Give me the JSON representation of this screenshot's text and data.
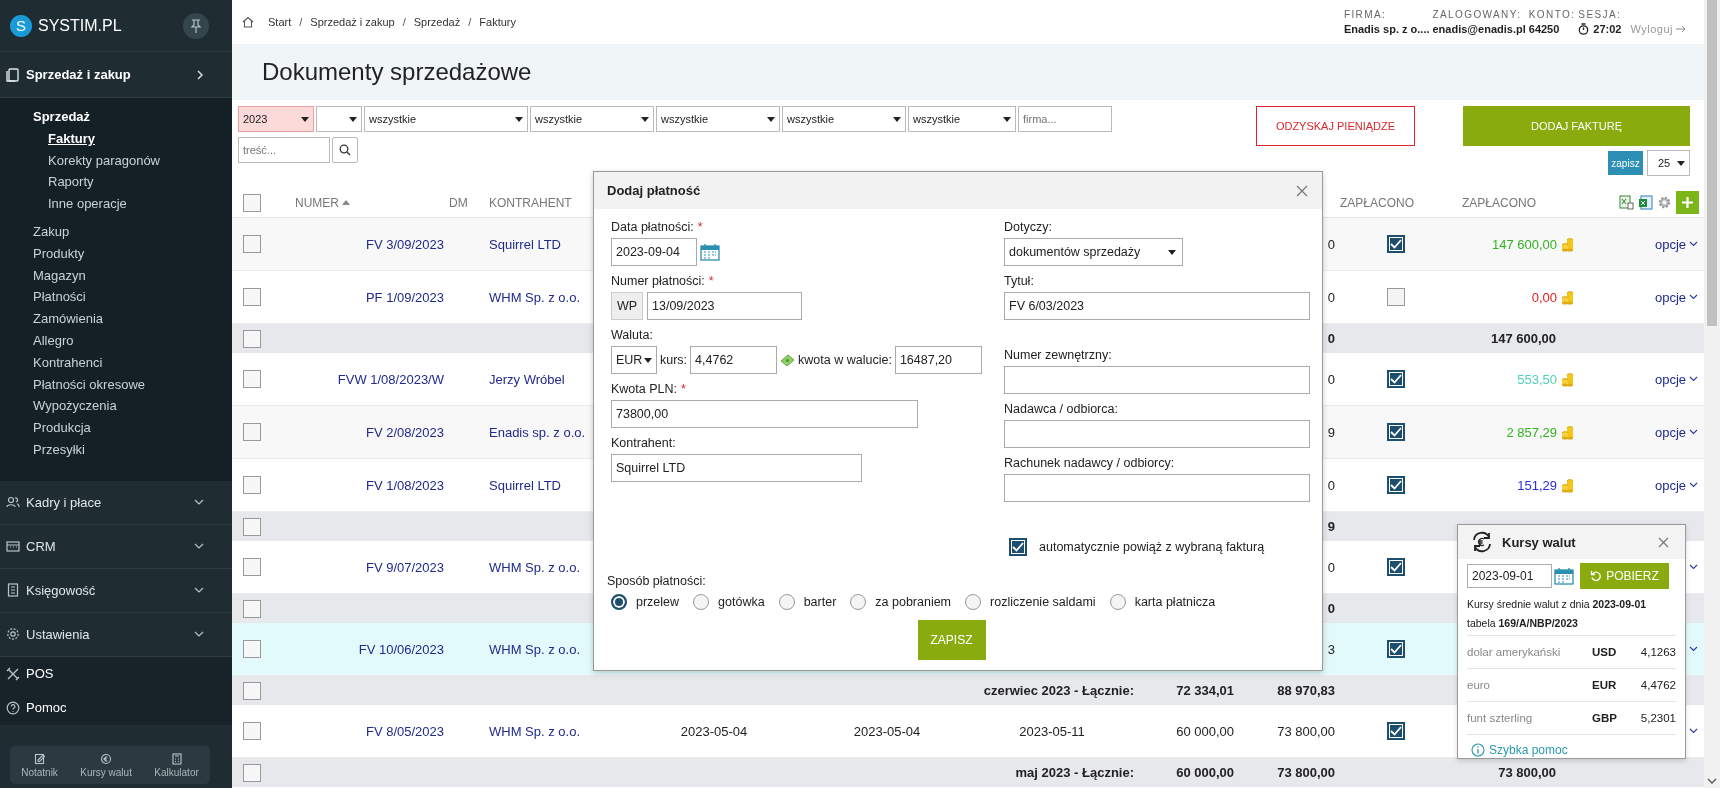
{
  "sidebar": {
    "logo_letter": "S",
    "brand": "SYSTIM.PL",
    "sections": [
      {
        "label": "Sprzedaż i zakup",
        "expanded": true,
        "children": [
          {
            "label": "Sprzedaż",
            "selected": false,
            "children": [
              {
                "label": "Faktury",
                "selected": true
              },
              {
                "label": "Korekty paragonów",
                "selected": false
              },
              {
                "label": "Raporty",
                "selected": false
              },
              {
                "label": "Inne operacje",
                "selected": false
              }
            ]
          },
          {
            "label": "Zakup",
            "selected": false
          },
          {
            "label": "Produkty",
            "selected": false
          },
          {
            "label": "Magazyn",
            "selected": false
          },
          {
            "label": "Płatności",
            "selected": false
          },
          {
            "label": "Zamówienia",
            "selected": false
          },
          {
            "label": "Allegro",
            "selected": false
          },
          {
            "label": "Kontrahenci",
            "selected": false
          },
          {
            "label": "Płatności okresowe",
            "selected": false
          },
          {
            "label": "Wypożyczenia",
            "selected": false
          },
          {
            "label": "Produkcja",
            "selected": false
          },
          {
            "label": "Przesyłki",
            "selected": false
          }
        ]
      },
      {
        "label": "Kadry i płace",
        "expanded": false
      },
      {
        "label": "CRM",
        "expanded": false
      },
      {
        "label": "Księgowość",
        "expanded": false
      },
      {
        "label": "Ustawienia",
        "expanded": false
      },
      {
        "label": "POS"
      },
      {
        "label": "Pomoc"
      }
    ],
    "tools": [
      {
        "label": "Notatnik"
      },
      {
        "label": "Kursy walut"
      },
      {
        "label": "Kalkulator"
      }
    ]
  },
  "breadcrumb": {
    "separator": "/",
    "items": [
      "Start",
      "Sprzedaż i zakup",
      "Sprzedaż",
      "Faktury"
    ]
  },
  "session": [
    {
      "label": "FIRMA:",
      "value": "Enadis sp. z o...."
    },
    {
      "label": "ZALOGOWANY:",
      "value": "enadis@enadis.pl"
    },
    {
      "label": "KONTO:",
      "value": "64250"
    },
    {
      "label": "SESJA:",
      "value": "27:02",
      "kind": "timer"
    }
  ],
  "logout": "Wyloguj",
  "page_title": "Dokumenty sprzedażowe",
  "filters": [
    {
      "kind": "select",
      "value": "2023",
      "highlighted": true
    },
    {
      "kind": "select",
      "highlighted": false
    },
    {
      "kind": "select",
      "value": "wszystkie",
      "highlighted": false
    },
    {
      "kind": "select",
      "value": "wszystkie",
      "highlighted": false
    },
    {
      "kind": "select",
      "value": "wszystkie",
      "highlighted": false
    },
    {
      "kind": "select",
      "value": "wszystkie",
      "highlighted": false
    },
    {
      "kind": "select",
      "value": "wszystkie",
      "highlighted": false
    },
    {
      "kind": "input",
      "placeholder": "firma..."
    }
  ],
  "search": {
    "placeholder": "treść..."
  },
  "recover_button": "ODZYSKAJ PIENIĄDZE",
  "add_button": "DODAJ FAKTURĘ",
  "save_view_button": "zapisz",
  "page_size": "25",
  "table": {
    "all_checked": false,
    "columns": [
      {
        "kind": "number",
        "label": "NUMER"
      },
      {
        "kind": "dm",
        "label": "DM"
      },
      {
        "kind": "client",
        "label": "KONTRAHENT"
      },
      {
        "kind": "paid_flag",
        "label": "ZAPŁACONO"
      },
      {
        "kind": "paid_amount",
        "label": "ZAPŁACONO"
      }
    ],
    "rows": [
      {
        "kind": "invoice",
        "checked": false,
        "number": "FV 3/09/2023",
        "client": "Squirrel LTD",
        "gross": "0",
        "paid": true,
        "paid_amount": "147 600,00",
        "color": "#33b320",
        "options": "opcje",
        "highlighted": false
      },
      {
        "kind": "invoice",
        "checked": false,
        "number": "PF 1/09/2023",
        "client": "WHM Sp. z o.o.",
        "gross": "0",
        "paid": false,
        "paid_amount": "0,00",
        "color": "#e0201c",
        "options": "opcje",
        "highlighted": false
      },
      {
        "kind": "summary",
        "checked": false,
        "gross": "0",
        "paid_amount": "147 600,00"
      },
      {
        "kind": "invoice",
        "checked": false,
        "number": "FVW 1/08/2023/W",
        "client": "Jerzy Wróbel",
        "gross": "0",
        "paid": true,
        "paid_amount": "553,50",
        "color": "#4fd0b8",
        "options": "opcje",
        "highlighted": false
      },
      {
        "kind": "invoice",
        "checked": false,
        "number": "FV 2/08/2023",
        "client": "Enadis sp. z o.o.",
        "gross": "9",
        "paid": true,
        "paid_amount": "2 857,29",
        "color": "#33b320",
        "options": "opcje",
        "highlighted": false
      },
      {
        "kind": "invoice",
        "checked": false,
        "number": "FV 1/08/2023",
        "client": "Squirrel LTD",
        "gross": "0",
        "paid": true,
        "paid_amount": "151,29",
        "color": "#2b2be0",
        "options": "opcje",
        "highlighted": false
      },
      {
        "kind": "summary",
        "checked": false,
        "gross": "9"
      },
      {
        "kind": "invoice",
        "checked": false,
        "number": "FV 9/07/2023",
        "client": "WHM Sp. z o.o.",
        "gross": "0",
        "paid": true,
        "highlighted": false
      },
      {
        "kind": "summary",
        "checked": false,
        "gross": "0"
      },
      {
        "kind": "invoice",
        "checked": false,
        "number": "FV 10/06/2023",
        "client": "WHM Sp. z o.o.",
        "gross": "3",
        "paid": true,
        "highlighted": true
      },
      {
        "kind": "summary",
        "checked": false,
        "label": "czerwiec 2023 - Łącznie:",
        "net": "72 334,01",
        "gross": "88 970,83"
      },
      {
        "kind": "invoice",
        "checked": false,
        "number": "FV 8/05/2023",
        "client": "WHM Sp. z o.o.",
        "issue_date": "2023-05-04",
        "sale_date": "2023-05-04",
        "due_date": "2023-05-11",
        "net": "60 000,00",
        "gross": "73 800,00",
        "paid": true,
        "highlighted": false
      },
      {
        "kind": "summary",
        "checked": false,
        "label": "maj 2023 - Łącznie:",
        "net": "60 000,00",
        "gross": "73 800,00",
        "paid_amount": "73 800,00"
      }
    ]
  },
  "payment_dialog": {
    "title": "Dodaj płatność",
    "date": {
      "label": "Data płatności:",
      "required_mark": "*",
      "value": "2023-09-04"
    },
    "number": {
      "label": "Numer płatności:",
      "required_mark": "*",
      "prefix": "WP",
      "value": "13/09/2023"
    },
    "currency": {
      "label": "Waluta:",
      "value": "EUR",
      "rate_label": "kurs:",
      "rate": "4,4762",
      "amount_label": "kwota w walucie:",
      "amount": "16487,20"
    },
    "amount_pln": {
      "label": "Kwota PLN:",
      "required_mark": "*",
      "value": "73800,00"
    },
    "client": {
      "label": "Kontrahent:",
      "value": "Squirrel LTD"
    },
    "concerns": {
      "label": "Dotyczy:",
      "value": "dokumentów sprzedaży"
    },
    "title_field": {
      "label": "Tytuł:",
      "value": "FV 6/03/2023"
    },
    "external_number": {
      "label": "Numer zewnętrzny:"
    },
    "party": {
      "label": "Nadawca / odbiorca:"
    },
    "account": {
      "label": "Rachunek nadawcy / odbiorcy:"
    },
    "auto_link": {
      "label": "automatycznie powiąż z wybraną fakturą",
      "checked": true
    },
    "method_label": "Sposób płatności:",
    "methods": [
      {
        "label": "przelew",
        "selected": true
      },
      {
        "label": "gotówka",
        "selected": false
      },
      {
        "label": "barter",
        "selected": false
      },
      {
        "label": "za pobraniem",
        "selected": false
      },
      {
        "label": "rozliczenie saldami",
        "selected": false
      },
      {
        "label": "karta płatnicza",
        "selected": false
      }
    ],
    "save_button": "ZAPISZ"
  },
  "currency_rates": {
    "title": "Kursy walut",
    "date": "2023-09-01",
    "fetch_button": "POBIERZ",
    "info": "Kursy średnie walut z dnia **2023-09-01** tabela **169/A/NBP/2023**",
    "rates": [
      {
        "name": "dolar amerykański",
        "code": "USD",
        "value": "4,1263"
      },
      {
        "name": "euro",
        "code": "EUR",
        "value": "4,4762"
      },
      {
        "name": "funt szterling",
        "code": "GBP",
        "value": "5,2301"
      }
    ],
    "help_link": "Szybka pomoc"
  }
}
